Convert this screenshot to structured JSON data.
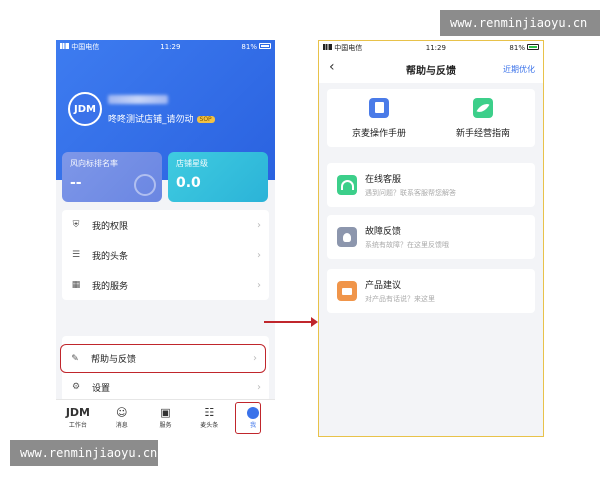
{
  "watermarks": {
    "top": "www.renminjiaoyu.cn",
    "bottom": "www.renminjiaoyu.cn"
  },
  "left_phone": {
    "status_bar": {
      "carrier": "中国电信",
      "time": "11:29",
      "battery": "81%"
    },
    "profile": {
      "avatar_text": "JDM",
      "shop_name": "咚咚测试店铺_请勿动",
      "badge": "SOP"
    },
    "cards": {
      "risk": {
        "title": "风向标排名率",
        "value": "--"
      },
      "star": {
        "title": "店铺星级",
        "value": "0.0"
      }
    },
    "menu": {
      "rights": "我的权限",
      "headlines": "我的头条",
      "services": "我的服务",
      "help": "帮助与反馈",
      "settings": "设置"
    },
    "tabbar": {
      "workbench": {
        "icon": "JDM",
        "label": "工作台"
      },
      "messages": {
        "label": "消息"
      },
      "services": {
        "label": "服务"
      },
      "jd_headlines": {
        "label": "麦头条"
      },
      "me": {
        "label": "我"
      }
    },
    "icons": [
      "shield-icon",
      "document-icon",
      "grid-icon",
      "edit-icon",
      "gear-icon",
      "smiley-icon",
      "bag-icon",
      "news-icon",
      "me-icon"
    ],
    "highlight_color": "#c0262c"
  },
  "right_phone": {
    "status_bar": {
      "carrier": "中国电信",
      "time": "11:29",
      "battery": "81%"
    },
    "nav": {
      "title": "帮助与反馈",
      "recent": "近期优化"
    },
    "guides": {
      "manual": "京麦操作手册",
      "newbie": "新手经营指南"
    },
    "services": [
      {
        "name": "在线客服",
        "desc": "遇到问题？联系客服帮您解答",
        "icon": "headset-icon"
      },
      {
        "name": "故障反馈",
        "desc": "系统有故障？在这里反馈哦",
        "icon": "bulb-icon"
      },
      {
        "name": "产品建议",
        "desc": "对产品有话说？来这里",
        "icon": "mail-icon"
      }
    ],
    "colors": {
      "accent": "#3a72ea",
      "green": "#3ccf8a",
      "orange": "#f0954a",
      "gray": "#8c96ad",
      "frame": "#e8c24a"
    }
  }
}
